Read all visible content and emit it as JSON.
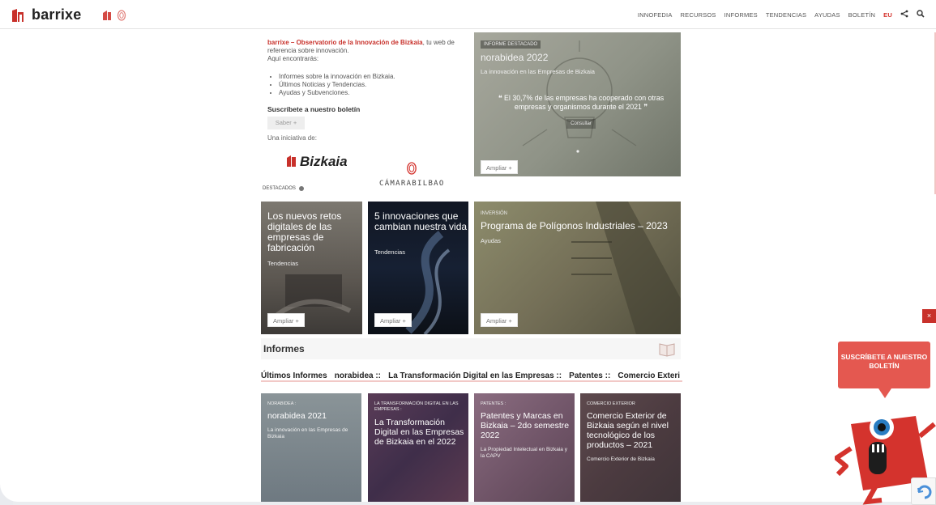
{
  "header": {
    "brand": "barrixe",
    "nav": [
      "INNOFEDIA",
      "RECURSOS",
      "INFORMES",
      "TENDENCIAS",
      "AYUDAS",
      "BOLETÍN"
    ],
    "lang": "EU",
    "share_icon": "share-icon",
    "search_icon": "search-icon"
  },
  "intro": {
    "accent": "barrixe – Observatorio de la Innovación de Bizkaia",
    "line1_rest": ", tu web de referencia sobre innovación.",
    "line2": "Aquí encontrarás:",
    "bullets": [
      "Informes sobre la innovación en Bizkaia.",
      "Últimos Noticias y Tendencias.",
      "Ayudas y Subvenciones."
    ],
    "subscribe_title": "Suscríbete a nuestro boletín",
    "subscribe_btn": "Saber +",
    "iniciativa": "Una iniciativa de:",
    "logo_bizkaia": "Bizkaia",
    "logo_camara": "CÁMARABILBAO"
  },
  "featured": {
    "tag": "INFORME DESTACADO",
    "title": "norabidea 2022",
    "subtitle": "La innovación en las Empresas de Bizkaia",
    "quote": "❝ El 30,7% de las empresas ha cooperado con otras empresas y organismos durante el 2021 ❞",
    "consultar": "Consultar",
    "ampliar": "Ampliar +"
  },
  "destacados": {
    "label": "DESTACADOS",
    "cards": [
      {
        "title": "Los nuevos retos digitales de las empresas de fabricación",
        "category": "Tendencias",
        "ampliar": "Ampliar +"
      },
      {
        "title": "5 innovaciones que cambian nuestra vida",
        "category": "Tendencias",
        "ampliar": "Ampliar +"
      },
      {
        "tag": "INVERSIÓN",
        "title": "Programa de Polígonos Industriales – 2023",
        "category": "Ayudas",
        "ampliar": "Ampliar +"
      }
    ]
  },
  "informes": {
    "title": "Informes",
    "tabs": [
      "Últimos Informes",
      "norabidea ::",
      "La Transformación Digital en las Empresas ::",
      "Patentes ::",
      "Comercio Exteri"
    ],
    "cards": [
      {
        "tag": "NORABIDEA :",
        "title": "norabidea 2021",
        "sub": "La innovación en las Empresas de Bizkaia"
      },
      {
        "tag": "LA TRANSFORMACIÓN DIGITAL EN LAS EMPRESAS :",
        "title": "La Transformación Digital en las Empresas de Bizkaia en el 2022",
        "sub": ""
      },
      {
        "tag": "PATENTES :",
        "title": "Patentes y Marcas en Bizkaia – 2do semestre 2022",
        "sub": "La Propiedad Intelectual en Bizkaia y la CAPV"
      },
      {
        "tag": "COMERCIO EXTERIOR",
        "title": "Comercio Exterior de Bizkaia según el nivel tecnológico de los productos – 2021",
        "sub": "Comercio Exterior de Bizkaia"
      }
    ]
  },
  "widget": {
    "close": "×",
    "bubble": "SUSCRÍBETE A NUESTRO BOLETÍN"
  },
  "colors": {
    "brand_red": "#c8312b",
    "bubble_red": "#e45850"
  }
}
